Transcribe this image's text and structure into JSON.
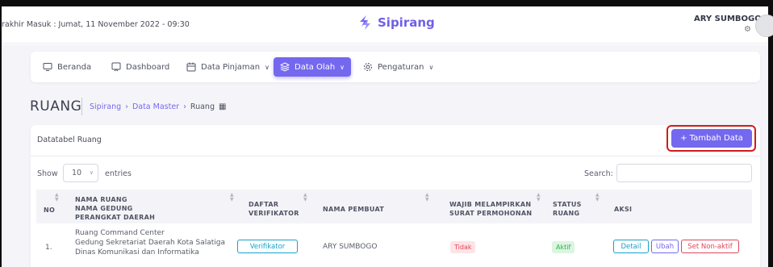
{
  "header": {
    "last_login": "rakhir Masuk : Jumat, 11 November 2022 - 09:30",
    "brand": "Sipirang",
    "user_name": "ARY SUMBOGO"
  },
  "nav": {
    "items": [
      {
        "label": "Beranda",
        "icon": "monitor-icon"
      },
      {
        "label": "Dashboard",
        "icon": "dashboard-icon"
      },
      {
        "label": "Data Pinjaman",
        "icon": "calendar-icon",
        "has_dropdown": true
      },
      {
        "label": "Data Olah",
        "icon": "layers-icon",
        "has_dropdown": true,
        "active": true
      },
      {
        "label": "Pengaturan",
        "icon": "gear-icon",
        "has_dropdown": true
      }
    ]
  },
  "page": {
    "title": "RUANG",
    "breadcrumb": [
      "Sipirang",
      "Data Master",
      "Ruang"
    ]
  },
  "card": {
    "title": "Datatabel Ruang",
    "add_button": "+ Tambah Data"
  },
  "table_controls": {
    "show_label": "Show",
    "entries_value": "10",
    "entries_label": "entries",
    "search_label": "Search:",
    "search_value": ""
  },
  "table": {
    "headers": {
      "no": "NO",
      "nama_ruang": [
        "NAMA RUANG",
        "NAMA GEDUNG",
        "PERANGKAT DAERAH"
      ],
      "verifikator": [
        "DAFTAR",
        "VERIFIKATOR"
      ],
      "pembuat": "NAMA PEMBUAT",
      "wajib": [
        "WAJIB MELAMPIRKAN",
        "SURAT PERMOHONAN"
      ],
      "status": [
        "STATUS",
        "RUANG"
      ],
      "aksi": "AKSI"
    },
    "rows": [
      {
        "no": "1.",
        "nama_ruang": "Ruang Command Center",
        "nama_gedung": "Gedung Sekretariat Daerah Kota Salatiga",
        "perangkat_daerah": "Dinas Komunikasi dan Informatika",
        "verifikator_button": "Verifikator",
        "pembuat": "ARY SUMBOGO",
        "wajib": "Tidak",
        "status": "Aktif",
        "actions": {
          "detail": "Detail",
          "ubah": "Ubah",
          "nonaktif": "Set Non-aktif"
        }
      }
    ]
  },
  "colors": {
    "primary": "#7468ef",
    "highlight": "#d21b1b",
    "info": "#17a2c8",
    "danger": "#e0455a",
    "success": "#2fb344"
  }
}
